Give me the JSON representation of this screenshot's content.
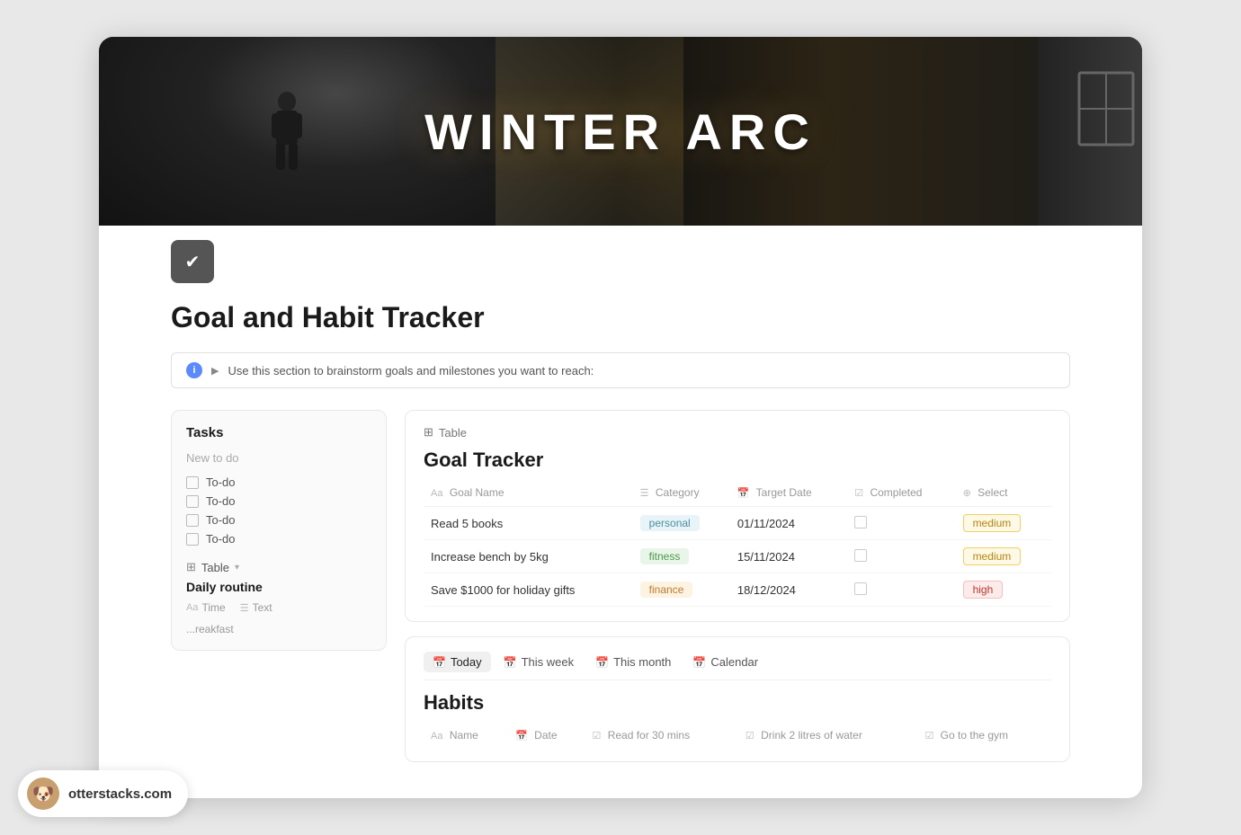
{
  "hero": {
    "title": "WINTER ARC"
  },
  "page": {
    "icon": "✔",
    "title": "Goal and Habit Tracker"
  },
  "callout": {
    "text": "Use this section to brainstorm goals and milestones you want to reach:"
  },
  "tasks": {
    "section_title": "Tasks",
    "new_label": "New to do",
    "items": [
      {
        "label": "To-do"
      },
      {
        "label": "To-do"
      },
      {
        "label": "To-do"
      },
      {
        "label": "To-do"
      }
    ]
  },
  "daily_routine": {
    "table_label": "Table",
    "section_title": "Daily routine",
    "col_time": "Time",
    "col_text": "Text",
    "partial_text": "...reakfast"
  },
  "goal_tracker": {
    "table_label": "Table",
    "section_title": "Goal Tracker",
    "columns": {
      "goal_name": "Goal Name",
      "category": "Category",
      "target_date": "Target Date",
      "completed": "Completed",
      "select": "Select"
    },
    "rows": [
      {
        "goal": "Read 5 books",
        "category": "personal",
        "category_type": "personal",
        "date": "01/11/2024",
        "priority": "medium"
      },
      {
        "goal": "Increase bench by 5kg",
        "category": "fitness",
        "category_type": "fitness",
        "date": "15/11/2024",
        "priority": "medium"
      },
      {
        "goal": "Save $1000 for holiday gifts",
        "category": "finance",
        "category_type": "finance",
        "date": "18/12/2024",
        "priority": "high"
      }
    ]
  },
  "habits": {
    "tabs": [
      {
        "label": "Today",
        "icon": "📅",
        "active": true
      },
      {
        "label": "This week",
        "icon": "📅",
        "active": false
      },
      {
        "label": "This month",
        "icon": "📅",
        "active": false
      },
      {
        "label": "Calendar",
        "icon": "📅",
        "active": false
      }
    ],
    "section_title": "Habits",
    "columns": {
      "name": "Name",
      "date": "Date",
      "read": "Read for 30 mins",
      "water": "Drink 2 litres of water",
      "gym": "Go to the gym"
    }
  },
  "watermark": {
    "site": "otterstacks.com"
  }
}
